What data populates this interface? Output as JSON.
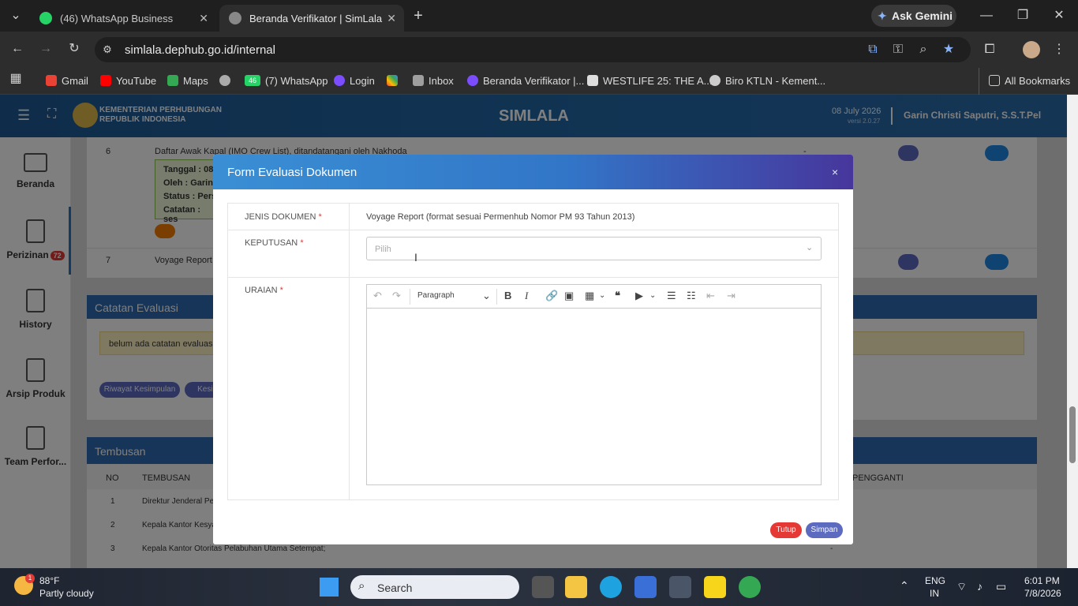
{
  "browser": {
    "tabs": [
      {
        "label": "(46) WhatsApp Business",
        "active": false,
        "color": "#25d366"
      },
      {
        "label": "Beranda Verifikator | SimLala",
        "active": true,
        "color": "#888888"
      }
    ],
    "ask_gemini": "Ask Gemini",
    "url": "simlala.dephub.go.id/internal",
    "bookmarks": [
      {
        "label": "Gmail",
        "color": "#ea4335"
      },
      {
        "label": "YouTube",
        "color": "#ff0000"
      },
      {
        "label": "Maps",
        "color": "#34a853"
      },
      {
        "label": "(7) WhatsApp",
        "color": "#25d366"
      },
      {
        "label": "Login",
        "color": "#7c4dff"
      },
      {
        "label": "Inbox",
        "color": "#9e9e9e"
      },
      {
        "label": "Beranda Verifikator |...",
        "color": "#7c4dff"
      },
      {
        "label": "WESTLIFE 25: THE A...",
        "color": "#dddddd"
      },
      {
        "label": "Biro KTLN - Kement...",
        "color": "#cccccc"
      }
    ],
    "all_bookmarks": "All Bookmarks",
    "whatsapp_badge": "46"
  },
  "app": {
    "org_line1": "KEMENTERIAN PERHUBUNGAN",
    "org_line2": "REPUBLIK INDONESIA",
    "title": "SIMLALA",
    "date": "08 July 2026",
    "version": "versi 2.0.27",
    "user": "Garin Christi Saputri, S.S.T.Pel",
    "sidebar": [
      {
        "label": "Beranda"
      },
      {
        "label": "Perizinan",
        "badge": "72"
      },
      {
        "label": "History"
      },
      {
        "label": "Arsip Produk"
      },
      {
        "label": "Team Perfor..."
      }
    ]
  },
  "background": {
    "row6_no": "6",
    "row6_text": "Daftar Awak Kapal (IMO Crew List), ditandatangani oleh Nakhoda",
    "row6_dash": "-",
    "detail_tanggal": "Tanggal : 08",
    "detail_oleh": "Oleh : Garin",
    "detail_status": "Status : Pers",
    "detail_catatan": "Catatan : ses",
    "row7_no": "7",
    "row7_text": "Voyage Report (",
    "catatan_title": "Catatan Evaluasi",
    "catatan_empty": "belum ada catatan evaluasi",
    "riwayat_btn": "Riwayat Kesimpulan",
    "kesim_btn": "Kesim",
    "tembusan_title": "Tembusan",
    "tembusan_col_no": "NO",
    "tembusan_col_name": "TEMBUSAN",
    "tembusan_col_pengganti": "PENGGANTI",
    "tembusan_rows": [
      {
        "no": "1",
        "name": "Direktur Jenderal Pe"
      },
      {
        "no": "2",
        "name": "Kepala Kantor Kesya"
      },
      {
        "no": "3",
        "name": "Kepala Kantor Otoritas Pelabuhan Utama Setempat;"
      }
    ],
    "tembusan_row3_dash": "-"
  },
  "modal": {
    "title": "Form Evaluasi Dokumen",
    "close": "×",
    "jenis_label": "JENIS DOKUMEN",
    "jenis_value": "Voyage Report (format sesuai Permenhub Nomor PM 93 Tahun 2013)",
    "keputusan_label": "KEPUTUSAN",
    "keputusan_placeholder": "Pilih",
    "uraian_label": "URAIAN",
    "paragraph": "Paragraph",
    "tutup": "Tutup",
    "simpan": "Simpan"
  },
  "taskbar": {
    "temp": "88°F",
    "weather": "Partly cloudy",
    "weather_badge": "1",
    "search": "Search",
    "lang1": "ENG",
    "lang2": "IN",
    "time": "6:01 PM",
    "date": "7/8/2026"
  }
}
